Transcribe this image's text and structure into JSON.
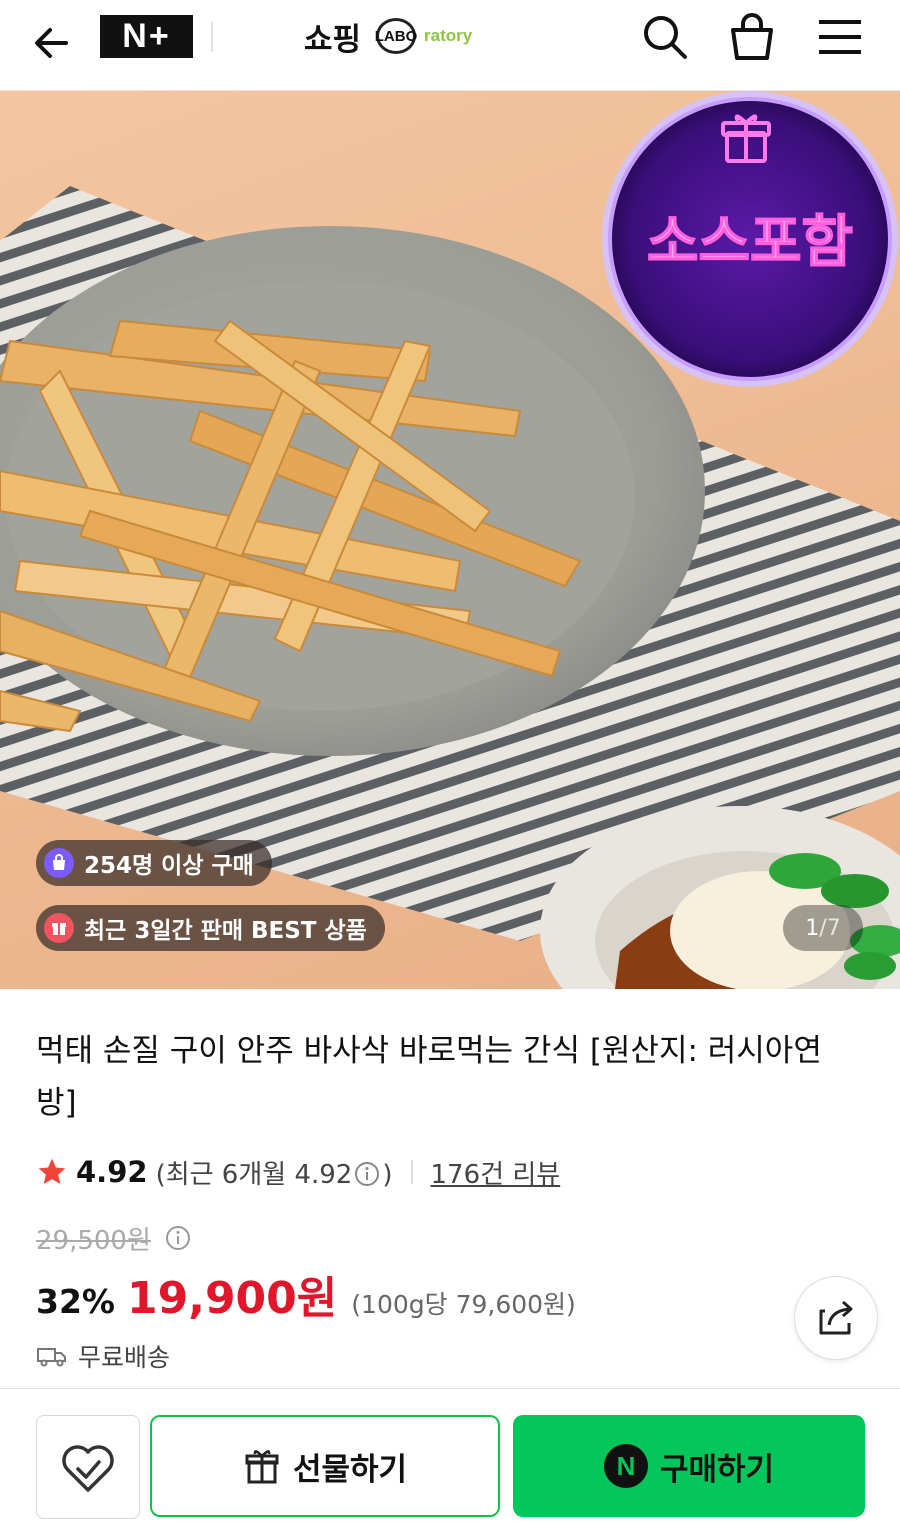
{
  "header": {
    "back_icon": "arrow-left-icon",
    "logo_text": "N+",
    "shopping_title": "쇼핑",
    "labo_circle_text": "LABO",
    "labo_suffix_text": "ratory",
    "search_icon": "search-icon",
    "cart_icon": "shopping-bag-icon",
    "menu_icon": "hamburger-menu-icon"
  },
  "hero": {
    "sticker_text": "소스포함",
    "sticker_icon": "gift-icon",
    "badges": [
      {
        "icon": "shopping-bag-icon",
        "text": "254명 이상 구매",
        "color": "#7b5cff"
      },
      {
        "icon": "gift-box-icon",
        "text": "최근 3일간 판매 BEST 상품",
        "color": "#f0555f"
      }
    ],
    "counter_current": "1",
    "counter_total": "/7"
  },
  "product": {
    "title": "먹태 손질 구이 안주 바사삭 바로먹는 간식 [원산지: 러시아연방]",
    "rating_icon": "star-icon",
    "rating_score": "4.92",
    "rating_recent_open": "(최근 6개월 4.92",
    "rating_recent_close": ")",
    "review_link": "176건 리뷰",
    "original_price": "29,500원",
    "discount": "32%",
    "sale_price": "19,900원",
    "unit_price": "(100g당 79,600원)",
    "shipping": "무료배송"
  },
  "bottom_bar": {
    "wishlist_icon": "heart-check-icon",
    "gift_label": "선물하기",
    "buy_label": "구매하기",
    "buy_badge": "N"
  },
  "colors": {
    "accent_green": "#03c75a",
    "price_red": "#e0162b",
    "star_red": "#f04438"
  }
}
